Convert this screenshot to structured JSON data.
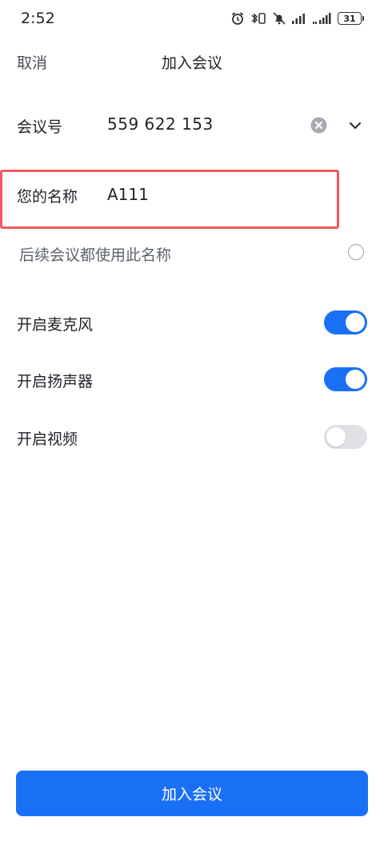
{
  "status_bar": {
    "time": "2:52",
    "battery_level": "31"
  },
  "header": {
    "cancel_label": "取消",
    "title": "加入会议"
  },
  "form": {
    "meeting_id": {
      "label": "会议号",
      "value": "559 622 153"
    },
    "display_name": {
      "label": "您的名称",
      "value": "A111"
    },
    "remember_name": {
      "label": "后续会议都使用此名称",
      "checked": false
    },
    "toggles": [
      {
        "label": "开启麦克风",
        "on": true
      },
      {
        "label": "开启扬声器",
        "on": true
      },
      {
        "label": "开启视频",
        "on": false
      }
    ]
  },
  "footer": {
    "join_label": "加入会议"
  },
  "colors": {
    "accent": "#1a70f5",
    "highlight_border": "#f0595e",
    "toggle_off": "#dfe1e5"
  }
}
